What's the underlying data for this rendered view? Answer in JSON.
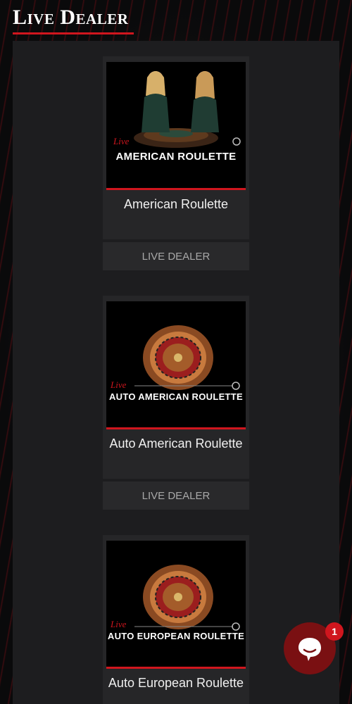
{
  "header": {
    "title": "Live Dealer"
  },
  "games": [
    {
      "thumb_live": "Live",
      "thumb_title": "AMERICAN ROULETTE",
      "name": "American Roulette",
      "category": "LIVE DEALER"
    },
    {
      "thumb_live": "Live",
      "thumb_title": "AUTO AMERICAN ROULETTE",
      "name": "Auto American Roulette",
      "category": "LIVE DEALER"
    },
    {
      "thumb_live": "Live",
      "thumb_title": "AUTO EUROPEAN ROULETTE",
      "name": "Auto European Roulette"
    }
  ],
  "chat": {
    "icon": "chat-bubble-icon",
    "unread_count": "1"
  },
  "colors": {
    "accent": "#d0161e",
    "chat_bg": "#7a1012"
  }
}
